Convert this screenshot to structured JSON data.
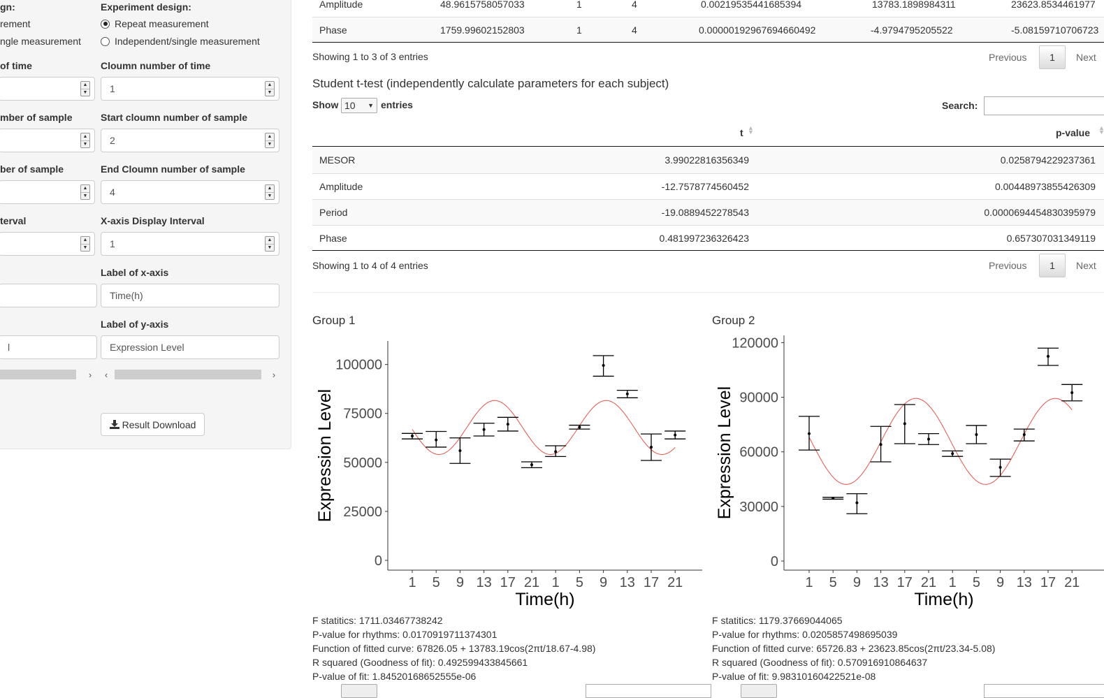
{
  "sidebar": {
    "left_col": {
      "design_label": "gn:",
      "radio_repeat": "rement",
      "radio_single": "ngle measurement",
      "time_label": "of time",
      "start_label": "mber of sample",
      "end_label": "ber of sample",
      "interval_label": "terval",
      "ylabel_value": "l"
    },
    "right_col": {
      "design_label": "Experiment design:",
      "radio_repeat": "Repeat measurement",
      "radio_single": "Independent/single measurement",
      "time_label": "Cloumn number of time",
      "time_value": "1",
      "start_label": "Start cloumn number of sample",
      "start_value": "2",
      "end_label": "End Cloumn number of sample",
      "end_value": "4",
      "interval_label": "X-axis Display Interval",
      "interval_value": "1",
      "xlabel_label": "Label of x-axis",
      "xlabel_value": "Time(h)",
      "ylabel_label": "Label of y-axis",
      "ylabel_value": "Expression Level"
    },
    "download_label": "Result Download"
  },
  "top_table": {
    "rows": [
      [
        "Amplitude",
        "48.9615758057033",
        "1",
        "4",
        "0.00219535441685394",
        "13783.1898984311",
        "23623.8534461977"
      ],
      [
        "Phase",
        "1759.99602152803",
        "1",
        "4",
        "0.00000192967694660492",
        "-4.9794795205522",
        "-5.08159710706723"
      ]
    ],
    "info": "Showing 1 to 3 of 3 entries",
    "prev": "Previous",
    "page": "1",
    "next": "Next"
  },
  "ttest": {
    "title": "Student t-test (independently calculate parameters for each subject)",
    "show": "Show",
    "length": "10",
    "entries": "entries",
    "search": "Search:",
    "col_t": "t",
    "col_p": "p-value",
    "rows": [
      [
        "MESOR",
        "3.99022816356349",
        "0.0258794229237361"
      ],
      [
        "Amplitude",
        "-12.7578774560452",
        "0.00448973855426309"
      ],
      [
        "Period",
        "-19.0889452278543",
        "0.0000694454830395979"
      ],
      [
        "Phase",
        "0.481997236326423",
        "0.657307031349119"
      ]
    ],
    "info": "Showing 1 to 4 of 4 entries",
    "prev": "Previous",
    "page": "1",
    "next": "Next"
  },
  "groups": [
    {
      "title": "Group 1",
      "stats": [
        "F statitics: 1711.03467738242",
        "P-value for rhythms: 0.0170919711374301",
        "Function of fitted curve: 67826.05 + 13783.19cos(2πt/18.67-4.98)",
        "R squared (Goodness of fit): 0.492599433845661",
        "P-value of fit: 1.84520168652555e-06"
      ]
    },
    {
      "title": "Group 2",
      "stats": [
        "F statitics: 1179.37669044065",
        "P-value for rhythms: 0.0205857498695039",
        "Function of fitted curve: 65726.83 + 23623.85cos(2πt/23.34-5.08)",
        "R squared (Goodness of fit): 0.570916910864637",
        "P-value of fit: 9.98310160422521e-08"
      ]
    }
  ],
  "chart_data": [
    {
      "type": "scatter",
      "xlabel": "Time(h)",
      "ylabel": "Expression Level",
      "categories": [
        "1",
        "5",
        "9",
        "13",
        "17",
        "21",
        "1",
        "5",
        "9",
        "13",
        "17",
        "21"
      ],
      "ylim": [
        -5000,
        112000
      ],
      "yticks": [
        0,
        25000,
        50000,
        75000,
        100000
      ],
      "ytick_labels": [
        "0",
        "25000",
        "50000",
        "75000",
        "100000"
      ],
      "means": [
        63500,
        61500,
        56000,
        66800,
        69500,
        48800,
        55500,
        68000,
        99500,
        85000,
        57800,
        64000
      ],
      "lower": [
        62000,
        57800,
        49500,
        63500,
        66000,
        47300,
        53000,
        67000,
        94000,
        83000,
        51000,
        62000
      ],
      "upper": [
        64800,
        65800,
        62500,
        70000,
        73000,
        50300,
        58500,
        69000,
        104500,
        86800,
        64500,
        66000
      ],
      "fit": {
        "mesor": 67826.05,
        "amplitude": 13783.19,
        "period": 18.67,
        "phase": 4.98
      },
      "line_color": "#e8524a",
      "grid": false
    },
    {
      "type": "scatter",
      "xlabel": "Time(h)",
      "ylabel": "Expression Level",
      "categories": [
        "1",
        "5",
        "9",
        "13",
        "17",
        "21",
        "1",
        "5",
        "9",
        "13",
        "17",
        "21"
      ],
      "ylim": [
        -5000,
        124000
      ],
      "yticks": [
        0,
        30000,
        60000,
        90000,
        120000
      ],
      "ytick_labels": [
        "0",
        "30000",
        "60000",
        "90000",
        "120000"
      ],
      "means": [
        70000,
        34500,
        32000,
        64000,
        75500,
        67000,
        59000,
        69500,
        51500,
        69500,
        112500,
        92500
      ],
      "lower": [
        61000,
        34000,
        26000,
        54500,
        64500,
        64000,
        57500,
        64500,
        46500,
        66000,
        107500,
        88000
      ],
      "upper": [
        79500,
        35000,
        37000,
        74000,
        86000,
        70000,
        60500,
        74500,
        56000,
        72500,
        117000,
        97000
      ],
      "fit": {
        "mesor": 65726.83,
        "amplitude": 23623.85,
        "period": 23.34,
        "phase": 5.08
      },
      "line_color": "#e8524a",
      "grid": false
    }
  ]
}
